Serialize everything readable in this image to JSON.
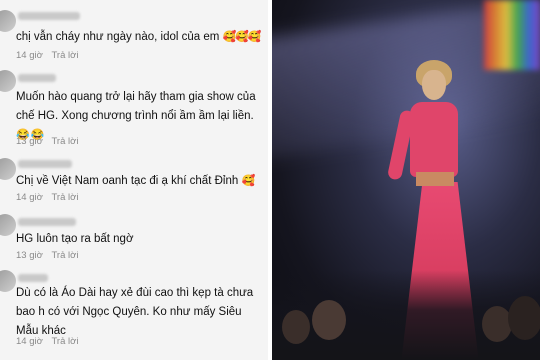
{
  "comments": [
    {
      "text": "chị vẫn cháy như ngày nào, idol của em",
      "emoji": "🥰🥰🥰",
      "time": "14 giờ",
      "reply": "Trả lời"
    },
    {
      "text": "Muốn hào quang trở lại hãy tham gia show của chế HG. Xong chương trình nổi ầm ầm lại liền.",
      "emoji": "😂 😂",
      "time": "13 giờ",
      "reply": "Trả lời"
    },
    {
      "text": "Chị về Việt Nam oanh tạc đi ạ khí chất Đỉnh",
      "emoji": "🥰",
      "time": "14 giờ",
      "reply": "Trả lời"
    },
    {
      "text": "HG luôn tạo ra bất ngờ",
      "emoji": "",
      "time": "13 giờ",
      "reply": "Trả lời"
    },
    {
      "text": "Dù có là Áo Dài hay xẻ đùi cao thì kẹp tà chưa bao h có với Ngọc Quyên. Ko như mấy Siêu Mẫu khác",
      "emoji": "",
      "time": "14 giờ",
      "reply": "Trả lời"
    }
  ],
  "photo": {
    "icon": "runway-photo",
    "colors": {
      "dress": "#e0456a",
      "stage": "#2b2d45"
    }
  }
}
